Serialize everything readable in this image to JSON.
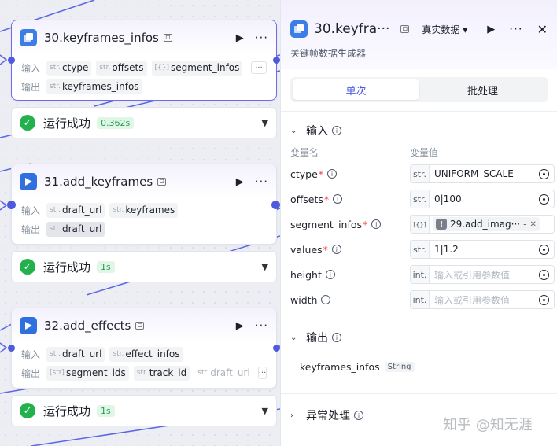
{
  "canvas": {
    "nodes": [
      {
        "title": "30.keyframes_infos",
        "input_label": "输入",
        "output_label": "输出",
        "inputs": [
          {
            "type": "str.",
            "name": "ctype"
          },
          {
            "type": "str.",
            "name": "offsets"
          },
          {
            "type": "[{}]",
            "name": "segment_infos"
          }
        ],
        "outputs": [
          {
            "type": "str.",
            "name": "keyframes_infos"
          }
        ],
        "more": "···"
      },
      {
        "title": "31.add_keyframes",
        "input_label": "输入",
        "output_label": "输出",
        "inputs": [
          {
            "type": "str.",
            "name": "draft_url"
          },
          {
            "type": "str.",
            "name": "keyframes"
          }
        ],
        "outputs": [
          {
            "type": "str.",
            "name": "draft_url"
          }
        ]
      },
      {
        "title": "32.add_effects",
        "input_label": "输入",
        "output_label": "输出",
        "inputs": [
          {
            "type": "str.",
            "name": "draft_url"
          },
          {
            "type": "str.",
            "name": "effect_infos"
          }
        ],
        "outputs": [
          {
            "type": "[str]",
            "name": "segment_ids"
          },
          {
            "type": "str.",
            "name": "track_id"
          },
          {
            "type": "str.",
            "name": "draft_url"
          }
        ],
        "more": "···"
      }
    ],
    "statuses": [
      {
        "text": "运行成功",
        "time": "0.362s"
      },
      {
        "text": "运行成功",
        "time": "1s"
      },
      {
        "text": "运行成功",
        "time": "1s"
      }
    ]
  },
  "panel": {
    "title": "30.keyfra···",
    "data_mode": "真实数据",
    "description": "关键帧数据生成器",
    "tabs": [
      "单次",
      "批处理"
    ],
    "input_section": "输入",
    "col_name": "变量名",
    "col_value": "变量值",
    "variables": [
      {
        "name": "ctype",
        "required": true,
        "type": "str.",
        "value": "UNIFORM_SCALE"
      },
      {
        "name": "offsets",
        "required": true,
        "type": "str.",
        "value": "0|100"
      },
      {
        "name": "segment_infos",
        "required": true,
        "type": "[{}]",
        "ref": "29.add_imag···",
        "ref_suffix": "-"
      },
      {
        "name": "values",
        "required": true,
        "type": "str.",
        "value": "1|1.2"
      },
      {
        "name": "height",
        "required": false,
        "type": "int.",
        "placeholder": "输入或引用参数值"
      },
      {
        "name": "width",
        "required": false,
        "type": "int.",
        "placeholder": "输入或引用参数值"
      }
    ],
    "output_section": "输出",
    "output": {
      "name": "keyframes_infos",
      "type": "String"
    },
    "error_section": "异常处理"
  },
  "watermark": "知乎 @知无涯",
  "colors": {
    "accent": "#4c5ce0",
    "success": "#22b14c",
    "port": "#4e5bdf",
    "required": "#f53f3f"
  }
}
